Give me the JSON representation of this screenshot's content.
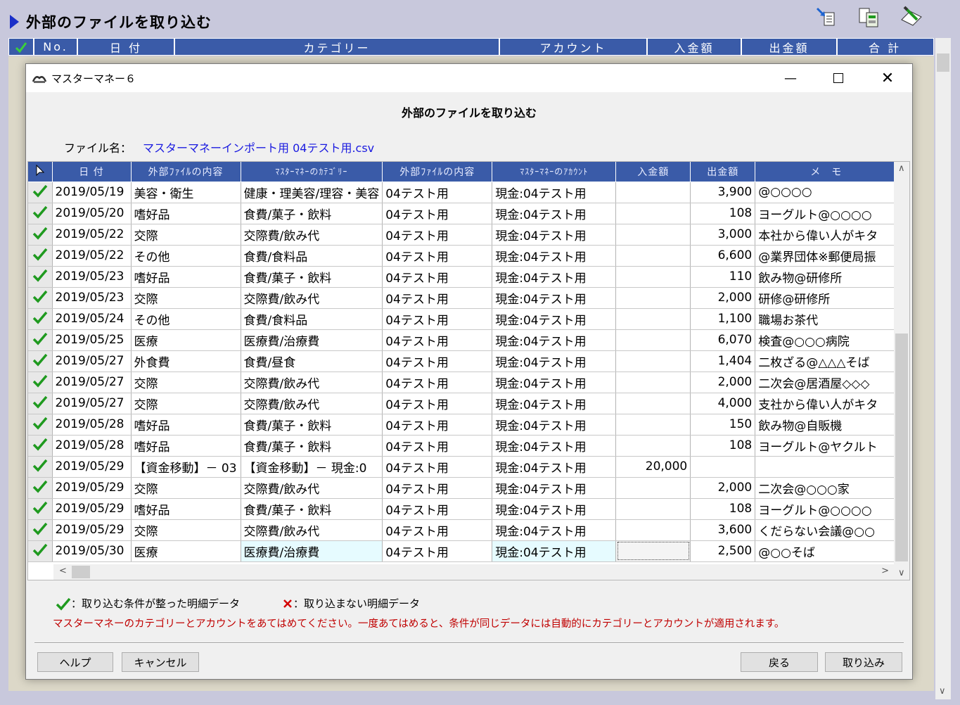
{
  "bg": {
    "title": "外部のファイルを取り込む",
    "columns": [
      "No.",
      "日 付",
      "カテゴリー",
      "アカウント",
      "入金額",
      "出金額",
      "合 計"
    ]
  },
  "dialog": {
    "title": "マスターマネー６",
    "heading": "外部のファイルを取り込む",
    "file_label": "ファイル名：",
    "file_name": "マスターマネーインポート用 04テスト用.csv",
    "columns": [
      "日 付",
      "外部ﾌｧｲﾙの内容",
      "ﾏｽﾀｰﾏﾈｰのｶﾃｺﾞﾘｰ",
      "外部ﾌｧｲﾙの内容",
      "ﾏｽﾀｰﾏﾈｰのｱｶｳﾝﾄ",
      "入金額",
      "出金額",
      "メ　モ"
    ],
    "rows": [
      {
        "date": "2019/05/19",
        "ext1": "美容・衛生",
        "cat": "健康・理美容/理容・美容",
        "ext2": "04テスト用",
        "acct": "現金:04テスト用",
        "in": "",
        "out": "3,900",
        "memo": "@○○○○"
      },
      {
        "date": "2019/05/20",
        "ext1": "嗜好品",
        "cat": "食費/菓子・飲料",
        "ext2": "04テスト用",
        "acct": "現金:04テスト用",
        "in": "",
        "out": "108",
        "memo": "ヨーグルト@○○○○"
      },
      {
        "date": "2019/05/22",
        "ext1": "交際",
        "cat": "交際費/飲み代",
        "ext2": "04テスト用",
        "acct": "現金:04テスト用",
        "in": "",
        "out": "3,000",
        "memo": "本社から偉い人がキタ"
      },
      {
        "date": "2019/05/22",
        "ext1": "その他",
        "cat": "食費/食料品",
        "ext2": "04テスト用",
        "acct": "現金:04テスト用",
        "in": "",
        "out": "6,600",
        "memo": "@業界団体※郵便局振"
      },
      {
        "date": "2019/05/23",
        "ext1": "嗜好品",
        "cat": "食費/菓子・飲料",
        "ext2": "04テスト用",
        "acct": "現金:04テスト用",
        "in": "",
        "out": "110",
        "memo": "飲み物@研修所"
      },
      {
        "date": "2019/05/23",
        "ext1": "交際",
        "cat": "交際費/飲み代",
        "ext2": "04テスト用",
        "acct": "現金:04テスト用",
        "in": "",
        "out": "2,000",
        "memo": "研修@研修所"
      },
      {
        "date": "2019/05/24",
        "ext1": "その他",
        "cat": "食費/食料品",
        "ext2": "04テスト用",
        "acct": "現金:04テスト用",
        "in": "",
        "out": "1,100",
        "memo": "職場お茶代"
      },
      {
        "date": "2019/05/25",
        "ext1": "医療",
        "cat": "医療費/治療費",
        "ext2": "04テスト用",
        "acct": "現金:04テスト用",
        "in": "",
        "out": "6,070",
        "memo": "検査@○○○病院"
      },
      {
        "date": "2019/05/27",
        "ext1": "外食費",
        "cat": "食費/昼食",
        "ext2": "04テスト用",
        "acct": "現金:04テスト用",
        "in": "",
        "out": "1,404",
        "memo": "二枚ざる@△△△そば"
      },
      {
        "date": "2019/05/27",
        "ext1": "交際",
        "cat": "交際費/飲み代",
        "ext2": "04テスト用",
        "acct": "現金:04テスト用",
        "in": "",
        "out": "2,000",
        "memo": "二次会@居酒屋◇◇◇"
      },
      {
        "date": "2019/05/27",
        "ext1": "交際",
        "cat": "交際費/飲み代",
        "ext2": "04テスト用",
        "acct": "現金:04テスト用",
        "in": "",
        "out": "4,000",
        "memo": "支社から偉い人がキタ"
      },
      {
        "date": "2019/05/28",
        "ext1": "嗜好品",
        "cat": "食費/菓子・飲料",
        "ext2": "04テスト用",
        "acct": "現金:04テスト用",
        "in": "",
        "out": "150",
        "memo": "飲み物@自販機"
      },
      {
        "date": "2019/05/28",
        "ext1": "嗜好品",
        "cat": "食費/菓子・飲料",
        "ext2": "04テスト用",
        "acct": "現金:04テスト用",
        "in": "",
        "out": "108",
        "memo": "ヨーグルト@ヤクルト"
      },
      {
        "date": "2019/05/29",
        "ext1": "【資金移動】－ 03",
        "cat": "【資金移動】－ 現金:0",
        "ext2": "04テスト用",
        "acct": "現金:04テスト用",
        "in": "20,000",
        "out": "",
        "memo": ""
      },
      {
        "date": "2019/05/29",
        "ext1": "交際",
        "cat": "交際費/飲み代",
        "ext2": "04テスト用",
        "acct": "現金:04テスト用",
        "in": "",
        "out": "2,000",
        "memo": "二次会@○○○家"
      },
      {
        "date": "2019/05/29",
        "ext1": "嗜好品",
        "cat": "食費/菓子・飲料",
        "ext2": "04テスト用",
        "acct": "現金:04テスト用",
        "in": "",
        "out": "108",
        "memo": "ヨーグルト@○○○○"
      },
      {
        "date": "2019/05/29",
        "ext1": "交際",
        "cat": "交際費/飲み代",
        "ext2": "04テスト用",
        "acct": "現金:04テスト用",
        "in": "",
        "out": "3,600",
        "memo": "くだらない会議@○○"
      },
      {
        "date": "2019/05/30",
        "ext1": "医療",
        "cat": "医療費/治療費",
        "ext2": "04テスト用",
        "acct": "現金:04テスト用",
        "in": "",
        "out": "2,500",
        "memo": "@○○そば"
      }
    ],
    "legend_ok": "：取り込む条件が整った明細データ",
    "legend_ng": "：取り込まない明細データ",
    "note": "マスターマネーのカテゴリーとアカウントをあてはめてください。一度あてはめると、条件が同じデータには自動的にカテゴリーとアカウントが適用されます。",
    "buttons": {
      "help": "ヘルプ",
      "cancel": "キャンセル",
      "back": "戻る",
      "import": "取り込み"
    }
  },
  "colors": {
    "header": "#3a5ba8",
    "check": "#1f9a1f",
    "error": "#d40000",
    "link": "#1a1ae0"
  },
  "icons": [
    "import-arrow-icon",
    "copy-data-icon",
    "edit-pencil-icon",
    "check-icon",
    "x-icon",
    "pointer-icon",
    "minimize-icon",
    "maximize-icon",
    "close-icon"
  ]
}
